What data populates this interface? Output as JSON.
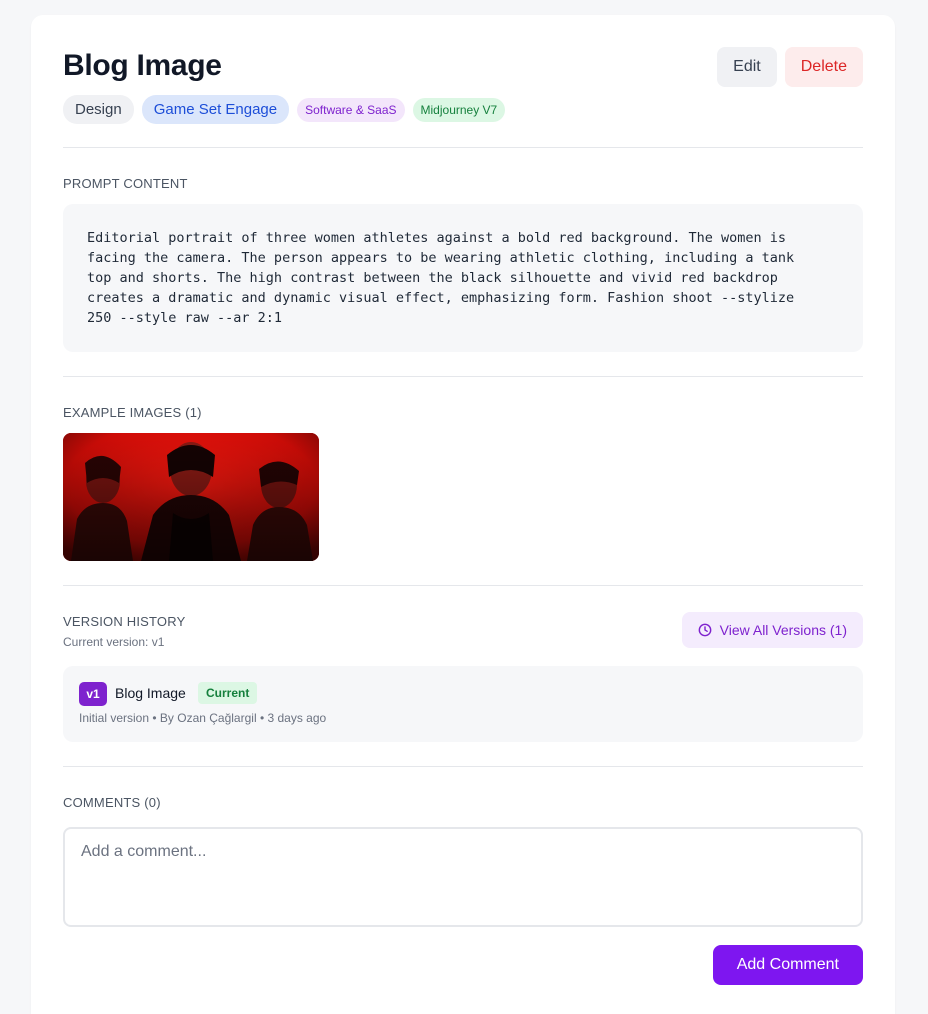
{
  "prompt": {
    "title": "Blog Image",
    "edit_label": "Edit",
    "delete_label": "Delete",
    "tags": [
      "Design",
      "Game Set Engage",
      "Software & SaaS",
      "Midjourney V7"
    ],
    "content_label": "PROMPT CONTENT",
    "content": "Editorial portrait of three women athletes against a bold red background. The women is\nfacing the camera. The person appears to be wearing athletic clothing, including a tank\ntop and shorts. The high contrast between the black silhouette and vivid red backdrop\ncreates a dramatic and dynamic visual effect, emphasizing form. Fashion shoot --stylize\n250 --style raw --ar 2:1"
  },
  "examples": {
    "label": "EXAMPLE IMAGES (1)"
  },
  "versions": {
    "label": "VERSION HISTORY",
    "current_label": "Current version: v1",
    "view_all_label": "View All Versions (1)",
    "items": [
      {
        "badge": "v1",
        "name": "Blog Image",
        "status": "Current",
        "meta": "Initial version • By Ozan Çağlargil • 3 days ago"
      }
    ]
  },
  "comments": {
    "label": "COMMENTS (0)",
    "placeholder": "Add a comment...",
    "submit_label": "Add Comment"
  },
  "colors": {
    "accent": "#7e16f0",
    "delete": "#dc2626",
    "current_badge": "#15803d"
  },
  "icons": {
    "view_all": "clock-icon"
  }
}
